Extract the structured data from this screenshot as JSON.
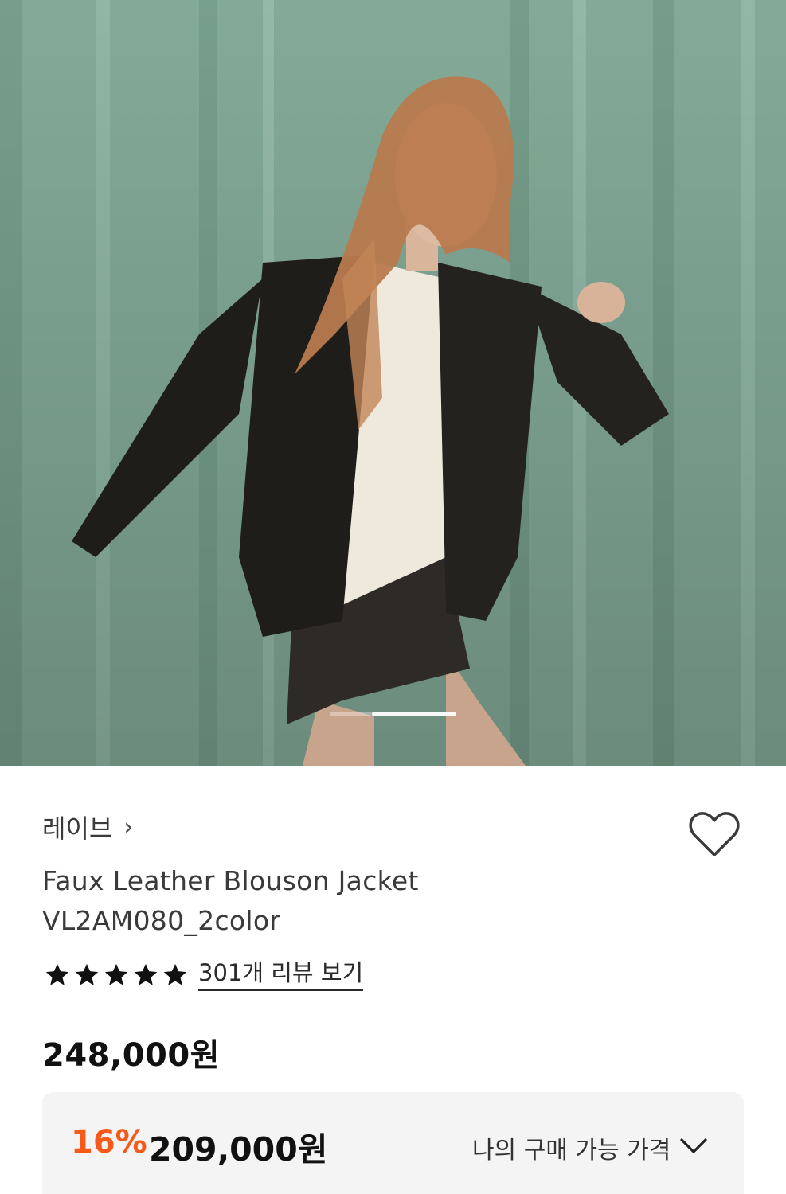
{
  "product": {
    "brand": "레이브",
    "brand_chevron": "›",
    "title": "Faux Leather Blouson Jacket VL2AM080_2color",
    "rating_stars": 5,
    "review_link": "301개 리뷰 보기",
    "original_price": "248,000원",
    "discount_percent": "16%",
    "sale_price": "209,000원",
    "my_price_label": "나의 구매 가능 가격"
  },
  "carousel": {
    "current_index": 2,
    "total": 3
  },
  "icons": {
    "wishlist": "heart-outline-icon",
    "brand_link": "chevron-right-icon",
    "rating": "star-icon",
    "expand": "chevron-down-icon"
  },
  "colors": {
    "discount": "#f55a1a",
    "price_box_bg": "#f4f4f4",
    "text_primary": "#111111",
    "text_secondary": "#3a3a3a"
  }
}
